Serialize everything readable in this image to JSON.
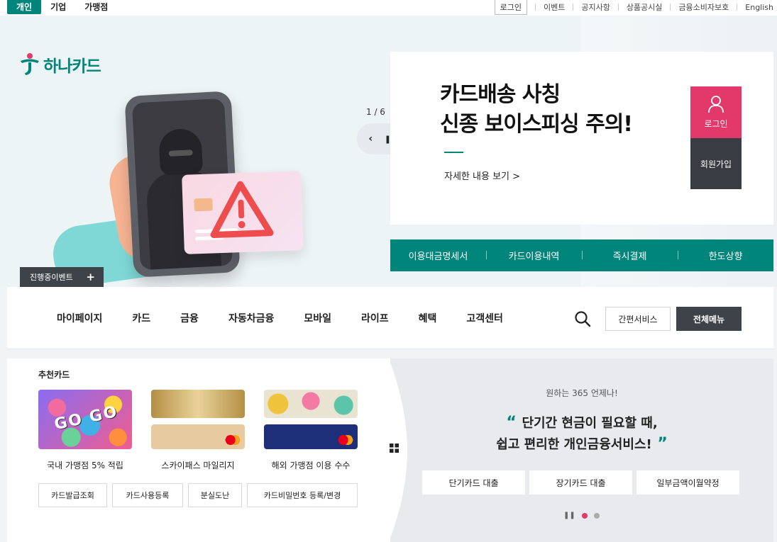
{
  "topbar": {
    "segments": [
      "개인",
      "기업",
      "가맹점"
    ],
    "login": "로그인",
    "links": [
      "이벤트",
      "공지사항",
      "상품공시실",
      "금융소비자보호",
      "English"
    ]
  },
  "logo": {
    "text": "하나카드"
  },
  "hero": {
    "pager": "1 / 6",
    "title_line1": "카드배송 사칭",
    "title_line2": "신종 보이스피싱 주의!",
    "link": "자세한 내용 보기 >",
    "event_tag": "진행중이벤트",
    "side_login": "로그인",
    "side_join": "회원가입",
    "quick_menu": [
      "이용대금명세서",
      "카드이용내역",
      "즉시결제",
      "한도상향"
    ]
  },
  "gnb": {
    "items": [
      "마이페이지",
      "카드",
      "금융",
      "자동차금융",
      "모바일",
      "라이프",
      "혜택",
      "고객센터"
    ],
    "easy_service": "간편서비스",
    "all_menu": "전체메뉴"
  },
  "recommend": {
    "title": "추천카드",
    "card1_text": "GO GO",
    "cards": [
      "국내 가맹점 5% 적립",
      "스카이패스 마일리지",
      "해외 가맹점 이용 수수"
    ],
    "pills": [
      "카드발급조회",
      "카드사용등록",
      "분실도난",
      "카드비밀번호 등록/변경"
    ]
  },
  "loan": {
    "sub": "원하는 365 언제나!",
    "line1": "단기간 현금이 필요할 때,",
    "line2": "쉽고 편리한 개인금융서비스!",
    "buttons": [
      "단기카드 대출",
      "장기카드 대출",
      "일부금액이월약정"
    ]
  },
  "colors": {
    "brand": "#00857b",
    "accent": "#e2386a",
    "dark": "#3e4249"
  }
}
